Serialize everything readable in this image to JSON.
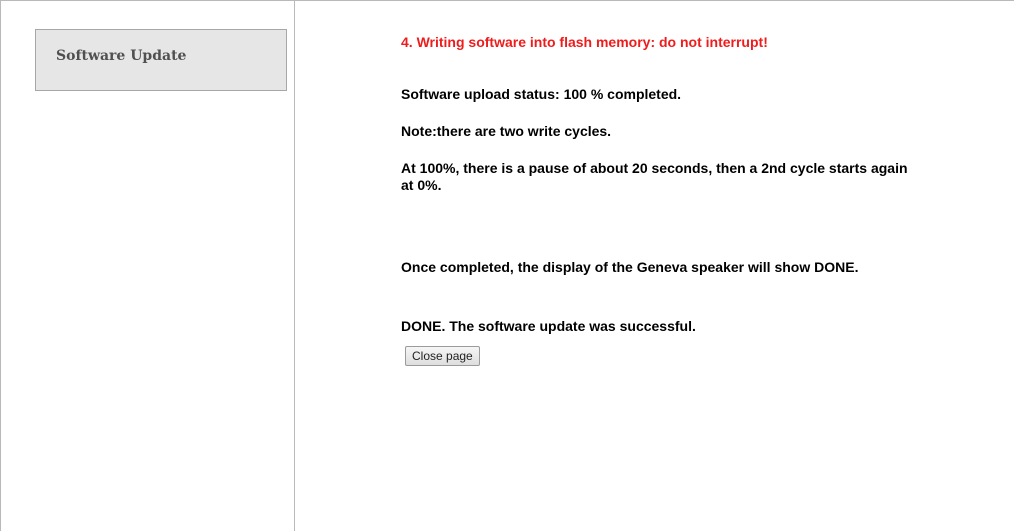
{
  "sidebar": {
    "items": [
      {
        "label": "Software Update"
      }
    ]
  },
  "main": {
    "warning": "4. Writing software into flash memory: do not interrupt!",
    "upload_status": "Software upload status: 100 % completed.",
    "note": "Note:there are two write cycles.",
    "pause_info": "At 100%, there is a pause of about 20 seconds, then a 2nd cycle starts again at 0%.",
    "completion_info": "Once completed, the display of the Geneva speaker will show DONE.",
    "done_message": "DONE. The software update was successful.",
    "close_button_label": "Close page"
  },
  "colors": {
    "warning": "#ee1c1c",
    "sidebar_item_bg": "#e6e6e6"
  }
}
